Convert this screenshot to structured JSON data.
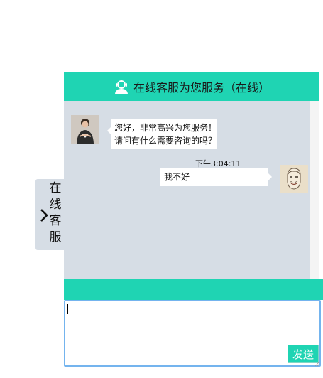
{
  "header": {
    "title": "在线客服为您服务（在线）",
    "icon": "customer-service-agent-icon",
    "accent": "#1fd4b3"
  },
  "side_tab": {
    "chars": [
      "在",
      "线",
      "客",
      "服"
    ],
    "icon": "chevron-right-icon",
    "background": "#d6dde5"
  },
  "messages": {
    "agent": {
      "line1": "您好，非常高兴为您服务！",
      "line2": "请问有什么需要咨询的吗？"
    },
    "timestamp": "下午3:04:11",
    "user": {
      "text": "我不好"
    }
  },
  "composer": {
    "input_value": "",
    "send_label": "发送"
  }
}
